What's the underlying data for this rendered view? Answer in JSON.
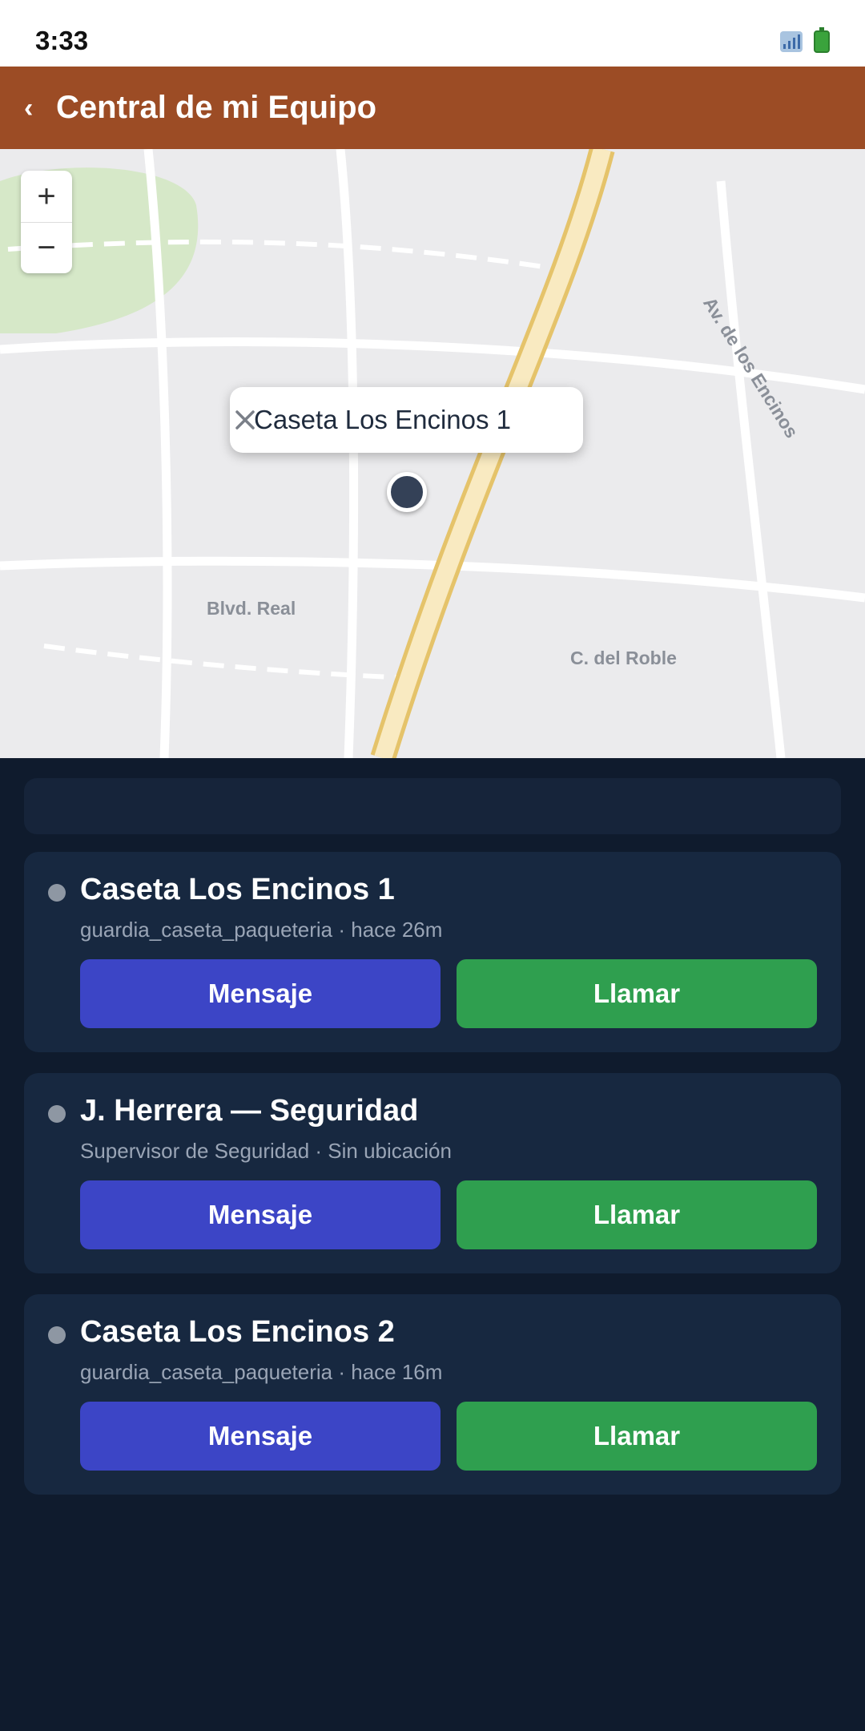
{
  "status": {
    "time": "3:33"
  },
  "header": {
    "title": "Central de mi Equipo",
    "back_icon": "chevron-left-icon"
  },
  "map": {
    "zoom_in": "+",
    "zoom_out": "−",
    "popup_label": "Caseta Los Encinos 1",
    "streets": {
      "blvd": "Blvd. Real",
      "roble": "C. del Roble",
      "encinos": "Av. de los Encinos"
    },
    "colors": {
      "highway": "#f9eac1",
      "highway_border": "#e5c36a",
      "park": "#d6e8c8"
    }
  },
  "team": [
    {
      "name": "Caseta Los Encinos 1",
      "meta": "guardia_caseta_paqueteria · hace 26m",
      "message_label": "Mensaje",
      "call_label": "Llamar"
    },
    {
      "name": "J. Herrera — Seguridad",
      "meta": "Supervisor de Seguridad · Sin ubicación",
      "message_label": "Mensaje",
      "call_label": "Llamar"
    },
    {
      "name": "Caseta Los Encinos 2",
      "meta": "guardia_caseta_paqueteria · hace 16m",
      "message_label": "Mensaje",
      "call_label": "Llamar"
    }
  ],
  "colors": {
    "header": "#9c4c25",
    "message_button": "#3c45c6",
    "call_button": "#2f9f4f",
    "background": "#0f1b2d",
    "card": "#172840"
  }
}
